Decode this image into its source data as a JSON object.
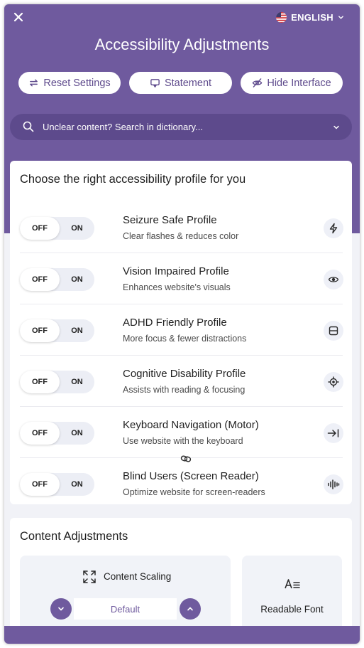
{
  "header": {
    "language": "ENGLISH",
    "title": "Accessibility Adjustments"
  },
  "actions": {
    "reset": "Reset Settings",
    "statement": "Statement",
    "hide": "Hide Interface"
  },
  "search": {
    "placeholder": "Unclear content? Search in dictionary..."
  },
  "profiles": {
    "heading": "Choose the right accessibility profile for you",
    "off_label": "OFF",
    "on_label": "ON",
    "items": [
      {
        "name": "Seizure Safe Profile",
        "desc": "Clear flashes & reduces color",
        "icon": "lightning-icon",
        "state": "off"
      },
      {
        "name": "Vision Impaired Profile",
        "desc": "Enhances website's visuals",
        "icon": "eye-icon",
        "state": "off"
      },
      {
        "name": "ADHD Friendly Profile",
        "desc": "More focus & fewer distractions",
        "icon": "focus-window-icon",
        "state": "off"
      },
      {
        "name": "Cognitive Disability Profile",
        "desc": "Assists with reading & focusing",
        "icon": "target-icon",
        "state": "off"
      },
      {
        "name": "Keyboard Navigation (Motor)",
        "desc": "Use website with the keyboard",
        "icon": "arrow-to-line-icon",
        "state": "off"
      },
      {
        "name": "Blind Users (Screen Reader)",
        "desc": "Optimize website for screen-readers",
        "icon": "audio-wave-icon",
        "state": "off"
      }
    ]
  },
  "content": {
    "heading": "Content Adjustments",
    "scaling_label": "Content Scaling",
    "scaling_value": "Default",
    "readable_font_label": "Readable Font"
  },
  "colors": {
    "brand": "#6f5a9e",
    "brand_dark": "#5d4a8c",
    "surface": "#ffffff",
    "background": "#f1f2f7"
  }
}
